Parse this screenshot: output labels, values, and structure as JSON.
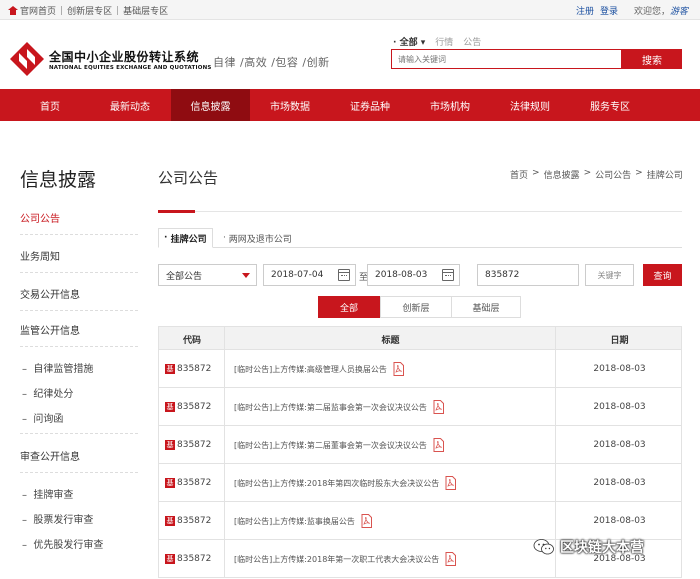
{
  "topbar": {
    "home": "官网首页",
    "innovation": "创新层专区",
    "basic": "基础层专区",
    "register": "注册",
    "login": "登录",
    "welcome": "欢迎您，",
    "guest": "游客"
  },
  "header": {
    "logo_cn": "全国中小企业股份转让系统",
    "logo_en": "NATIONAL EQUITIES EXCHANGE AND QUOTATIONS",
    "slogan": "自律 /高效 /包容 /创新",
    "search_tabs": [
      "全部",
      "行情",
      "公告"
    ],
    "search_placeholder": "请输入关键词",
    "search_button": "搜索"
  },
  "nav": {
    "items": [
      "首页",
      "最新动态",
      "信息披露",
      "市场数据",
      "证券品种",
      "市场机构",
      "法律规则",
      "服务专区"
    ]
  },
  "sidebar": {
    "title": "信息披露",
    "items": [
      "公司公告",
      "业务周知",
      "交易公开信息",
      "监管公开信息"
    ],
    "supervision_sub": [
      "自律监管措施",
      "纪律处分",
      "问询函"
    ],
    "review_title": "审查公开信息",
    "review_sub": [
      "挂牌审查",
      "股票发行审查",
      "优先股发行审查"
    ]
  },
  "main": {
    "title": "公司公告",
    "breadcrumb": [
      "首页",
      ">",
      "信息披露",
      ">",
      "公司公告",
      ">",
      "挂牌公司"
    ],
    "tabs": [
      "挂牌公司",
      "两网及退市公司"
    ],
    "filter": {
      "type": "全部公告",
      "start_date": "2018-07-04",
      "to": "至",
      "end_date": "2018-08-03",
      "code": "835872",
      "keyword_placeholder": "关键字",
      "query_button": "查询"
    },
    "segments": [
      "全部",
      "创新层",
      "基础层"
    ]
  },
  "table": {
    "headers": [
      "代码",
      "标题",
      "日期"
    ],
    "badge": "基",
    "rows": [
      {
        "code": "835872",
        "title": "[临时公告]上方传媒:高级管理人员换届公告",
        "date": "2018-08-03"
      },
      {
        "code": "835872",
        "title": "[临时公告]上方传媒:第二届监事会第一次会议决议公告",
        "date": "2018-08-03"
      },
      {
        "code": "835872",
        "title": "[临时公告]上方传媒:第二届董事会第一次会议决议公告",
        "date": "2018-08-03"
      },
      {
        "code": "835872",
        "title": "[临时公告]上方传媒:2018年第四次临时股东大会决议公告",
        "date": "2018-08-03"
      },
      {
        "code": "835872",
        "title": "[临时公告]上方传媒:监事换届公告",
        "date": "2018-08-03"
      },
      {
        "code": "835872",
        "title": "[临时公告]上方传媒:2018年第一次职工代表大会决议公告",
        "date": "2018-08-03"
      }
    ]
  },
  "watermark": "区块链大本营",
  "colors": {
    "brand_red": "#c8161d",
    "nav_active": "#8f0c11",
    "link_blue": "#1a4fa0"
  }
}
